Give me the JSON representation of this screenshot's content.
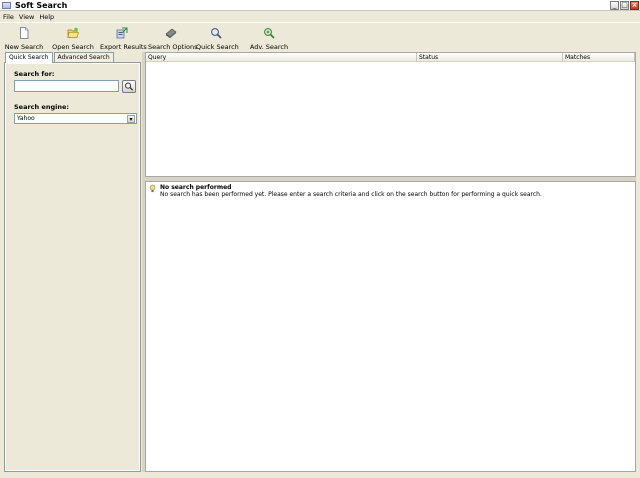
{
  "window": {
    "title": "Soft Search"
  },
  "menu": {
    "items": [
      "File",
      "View",
      "Help"
    ]
  },
  "toolbar": {
    "buttons": [
      {
        "label": "New Search",
        "icon": "new-document-icon"
      },
      {
        "label": "Open Search",
        "icon": "open-folder-icon"
      },
      {
        "label": "Export Results",
        "icon": "export-icon"
      },
      {
        "label": "Search Options",
        "icon": "options-icon"
      },
      {
        "label": "Quick Search",
        "icon": "magnifier-icon"
      },
      {
        "label": "Adv. Search",
        "icon": "advanced-search-icon"
      }
    ]
  },
  "left_panel": {
    "tabs": [
      "Quick Search",
      "Advanced Search"
    ],
    "search_for_label": "Search for:",
    "search_for_value": "",
    "search_engine_label": "Search engine:",
    "search_engine_value": "Yahoo"
  },
  "results": {
    "columns": [
      "Query",
      "Status",
      "Matches"
    ]
  },
  "message": {
    "title": "No search performed",
    "body": "No search has been performed yet. Please enter a search criteria and click on the search button for performing a quick search."
  }
}
